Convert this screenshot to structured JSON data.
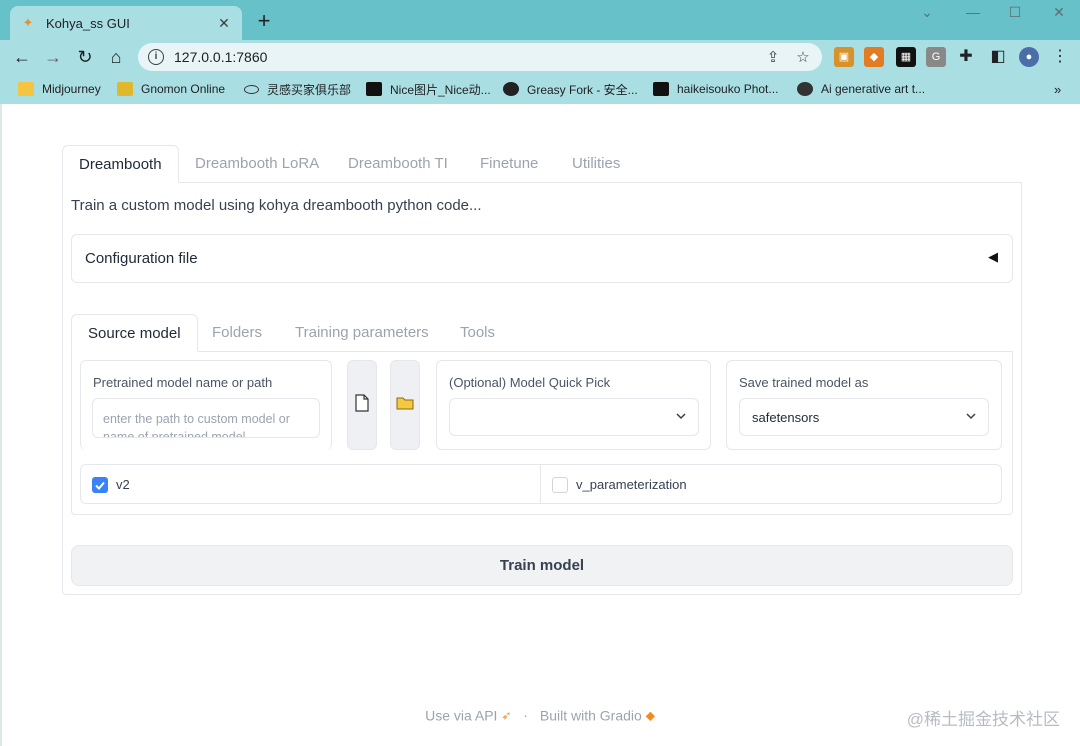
{
  "browser": {
    "tab_title": "Kohya_ss GUI",
    "url": "127.0.0.1:7860",
    "bookmarks": [
      {
        "label": "Midjourney",
        "icon": "folder-icon",
        "color": "#f4c542"
      },
      {
        "label": "Gnomon Online",
        "icon": "gnomon-icon",
        "color": "#e0b82c"
      },
      {
        "label": "灵感买家俱乐部",
        "icon": "fish-icon",
        "color": "#333333"
      },
      {
        "label": "Nice图片_Nice动...",
        "icon": "s-logo-icon",
        "color": "#111111"
      },
      {
        "label": "Greasy Fork - 安全...",
        "icon": "greasyfork-icon",
        "color": "#222222"
      },
      {
        "label": "haikeisouko Phot...",
        "icon": "st-logo-icon",
        "color": "#111111"
      },
      {
        "label": "Ai generative art t...",
        "icon": "globe-icon",
        "color": "#333333"
      }
    ],
    "more_bookmarks": "»"
  },
  "app": {
    "main_tabs": [
      "Dreambooth",
      "Dreambooth LoRA",
      "Dreambooth TI",
      "Finetune",
      "Utilities"
    ],
    "description": "Train a custom model using kohya dreambooth python code...",
    "config_label": "Configuration file",
    "config_arrow": "◀",
    "sub_tabs": [
      "Source model",
      "Folders",
      "Training parameters",
      "Tools"
    ],
    "pretrained": {
      "label": "Pretrained model name or path",
      "placeholder": "enter the path to custom model or name of pretrained model"
    },
    "quick_pick": {
      "label": "(Optional) Model Quick Pick",
      "value": ""
    },
    "save_as": {
      "label": "Save trained model as",
      "value": "safetensors"
    },
    "v2": {
      "label": "v2",
      "checked": true
    },
    "v_param": {
      "label": "v_parameterization",
      "checked": false
    },
    "train_button": "Train model"
  },
  "footer": {
    "api": "Use via API",
    "separator": "·",
    "built": "Built with Gradio"
  },
  "watermark": "@稀土掘金技术社区",
  "colors": {
    "chrome": "#67c1c9",
    "toolbar": "#a9dfe3",
    "checkbox": "#3b82f6"
  }
}
